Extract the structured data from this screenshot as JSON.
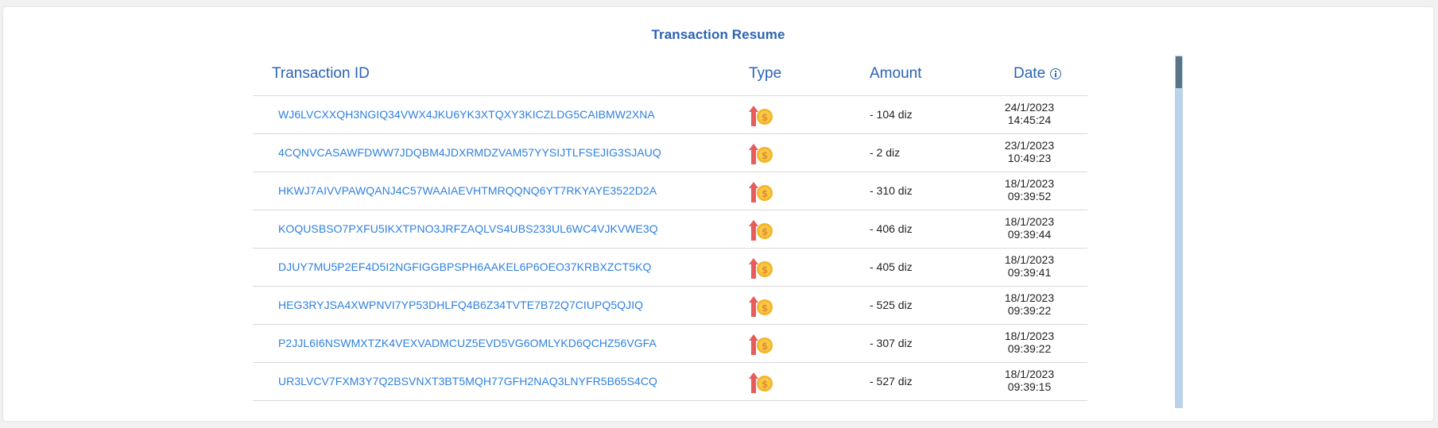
{
  "title": "Transaction Resume",
  "columns": {
    "transaction_id": "Transaction ID",
    "type": "Type",
    "amount": "Amount",
    "date": "Date"
  },
  "icons": {
    "type": "withdraw-coin-icon",
    "date_info": "info-icon"
  },
  "colors": {
    "accent": "#2c63b3",
    "link": "#2f80e0",
    "arrow": "#e85b5b",
    "coin": "#f5b324"
  },
  "rows": [
    {
      "id": "WJ6LVCXXQH3NGIQ34VWX4JKU6YK3XTQXY3KICZLDG5CAIBMW2XNA",
      "amount": "- 104 diz",
      "date": "24/1/2023",
      "time": "14:45:24"
    },
    {
      "id": "4CQNVCASAWFDWW7JDQBM4JDXRMDZVAM57YYSIJTLFSEJIG3SJAUQ",
      "amount": "- 2 diz",
      "date": "23/1/2023",
      "time": "10:49:23"
    },
    {
      "id": "HKWJ7AIVVPAWQANJ4C57WAAIAEVHTMRQQNQ6YT7RKYAYE3522D2A",
      "amount": "- 310 diz",
      "date": "18/1/2023",
      "time": "09:39:52"
    },
    {
      "id": "KOQUSBSO7PXFU5IKXTPNO3JRFZAQLVS4UBS233UL6WC4VJKVWE3Q",
      "amount": "- 406 diz",
      "date": "18/1/2023",
      "time": "09:39:44"
    },
    {
      "id": "DJUY7MU5P2EF4D5I2NGFIGGBPSPH6AAKEL6P6OEO37KRBXZCT5KQ",
      "amount": "- 405 diz",
      "date": "18/1/2023",
      "time": "09:39:41"
    },
    {
      "id": "HEG3RYJSA4XWPNVI7YP53DHLFQ4B6Z34TVTE7B72Q7CIUPQ5QJIQ",
      "amount": "- 525 diz",
      "date": "18/1/2023",
      "time": "09:39:22"
    },
    {
      "id": "P2JJL6I6NSWMXTZK4VEXVADMCUZ5EVD5VG6OMLYKD6QCHZ56VGFA",
      "amount": "- 307 diz",
      "date": "18/1/2023",
      "time": "09:39:22"
    },
    {
      "id": "UR3LVCV7FXM3Y7Q2BSVNXT3BT5MQH77GFH2NAQ3LNYFR5B65S4CQ",
      "amount": "- 527 diz",
      "date": "18/1/2023",
      "time": "09:39:15"
    }
  ]
}
